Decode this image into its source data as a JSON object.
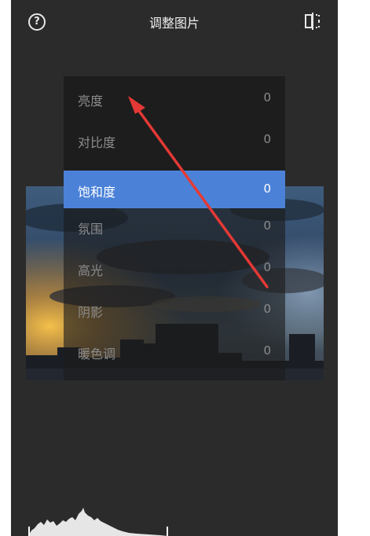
{
  "header": {
    "title": "调整图片",
    "help_icon_glyph": "?",
    "left_icon": "help-icon",
    "right_icon": "compare-icon"
  },
  "menu": {
    "items": [
      {
        "label": "亮度",
        "value": "0",
        "selected": false
      },
      {
        "label": "对比度",
        "value": "0",
        "selected": false
      },
      {
        "label": "饱和度",
        "value": "0",
        "selected": true
      },
      {
        "label": "氛围",
        "value": "0",
        "selected": false
      },
      {
        "label": "高光",
        "value": "0",
        "selected": false
      },
      {
        "label": "阴影",
        "value": "0",
        "selected": false
      },
      {
        "label": "暖色调",
        "value": "0",
        "selected": false
      }
    ]
  },
  "annotation": {
    "type": "red-arrow",
    "color": "#e53935"
  },
  "colors": {
    "background": "#2b2b2b",
    "accent": "#4b82d8",
    "menu_text": "#8c8c8c"
  }
}
